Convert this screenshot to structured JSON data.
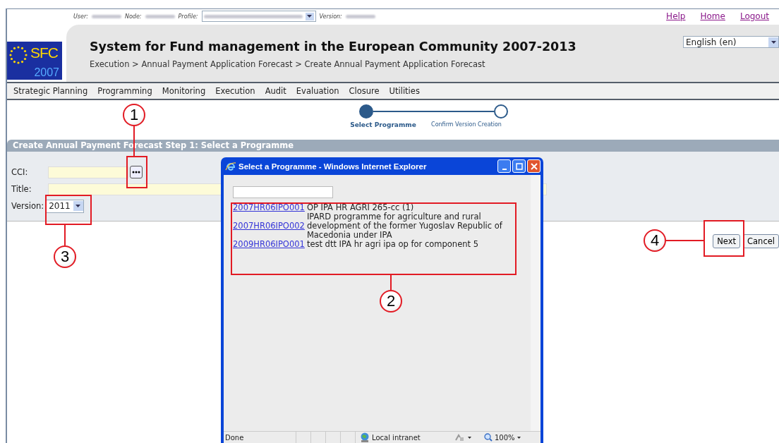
{
  "user_bar": {
    "fields": [
      {
        "label": "User:",
        "kind": "text"
      },
      {
        "label": "Node:",
        "kind": "text"
      },
      {
        "label": "Profile:",
        "kind": "select"
      },
      {
        "label": "Version:",
        "kind": "text"
      }
    ]
  },
  "top_links": [
    "Help",
    "Home",
    "Logout"
  ],
  "logo": {
    "text": "SFC",
    "year": "2007"
  },
  "header": {
    "title": "System for Fund management in the European Community 2007-2013",
    "breadcrumb": "Execution > Annual Payment Application Forecast > Create Annual Payment Application Forecast",
    "language": "English (en)"
  },
  "menu": [
    "Strategic Planning",
    "Programming",
    "Monitoring",
    "Execution",
    "Audit",
    "Evaluation",
    "Closure",
    "Utilities"
  ],
  "steps": [
    {
      "label": "Select Programme",
      "selected": true
    },
    {
      "label": "Confirm Version Creation",
      "selected": false
    }
  ],
  "section_title": "Create Annual Payment Forecast Step 1: Select a Programme",
  "form": {
    "fields": [
      {
        "label": "CCI:",
        "kind": "lookup"
      },
      {
        "label": "Title:",
        "kind": "text"
      },
      {
        "label": "Version:",
        "kind": "select",
        "value": "2011"
      }
    ]
  },
  "buttons": [
    "Next",
    "Cancel"
  ],
  "popup": {
    "title": "Select a Programme - Windows Internet Explorer",
    "rows": [
      {
        "code": "2007HR06IPO001",
        "name": "OP IPA HR AGRI 265-cc (1)"
      },
      {
        "code": "2007HR06IPO002",
        "name": "IPARD programme for agriculture and rural development of the former Yugoslav Republic of Macedonia under IPA"
      },
      {
        "code": "2009HR06IPO001",
        "name": "test dtt IPA hr agri ipa op for component 5"
      }
    ],
    "status": "Done",
    "zone": "Local intranet",
    "zoom": "100%"
  },
  "callouts": [
    "1",
    "2",
    "3",
    "4"
  ]
}
